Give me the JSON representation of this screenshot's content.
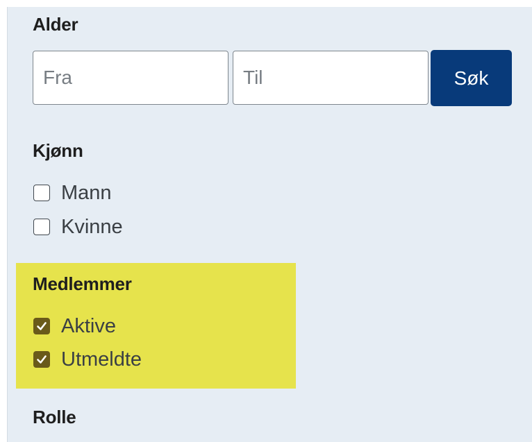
{
  "age_filter": {
    "heading": "Alder",
    "from_placeholder": "Fra",
    "from_value": "",
    "to_placeholder": "Til",
    "to_value": "",
    "search_label": "Søk"
  },
  "gender_filter": {
    "heading": "Kjønn",
    "options": [
      {
        "label": "Mann",
        "checked": false
      },
      {
        "label": "Kvinne",
        "checked": false
      }
    ]
  },
  "members_filter": {
    "heading": "Medlemmer",
    "options": [
      {
        "label": "Aktive",
        "checked": true
      },
      {
        "label": "Utmeldte",
        "checked": true
      }
    ],
    "highlight_color": "#e6e34c"
  },
  "role_filter": {
    "heading": "Rolle"
  },
  "colors": {
    "panel_background": "#e6edf4",
    "search_button": "#083a7a",
    "checkbox_checked": "#6a5a1a"
  },
  "icons": {
    "checkbox_checked": "checkmark-icon"
  }
}
